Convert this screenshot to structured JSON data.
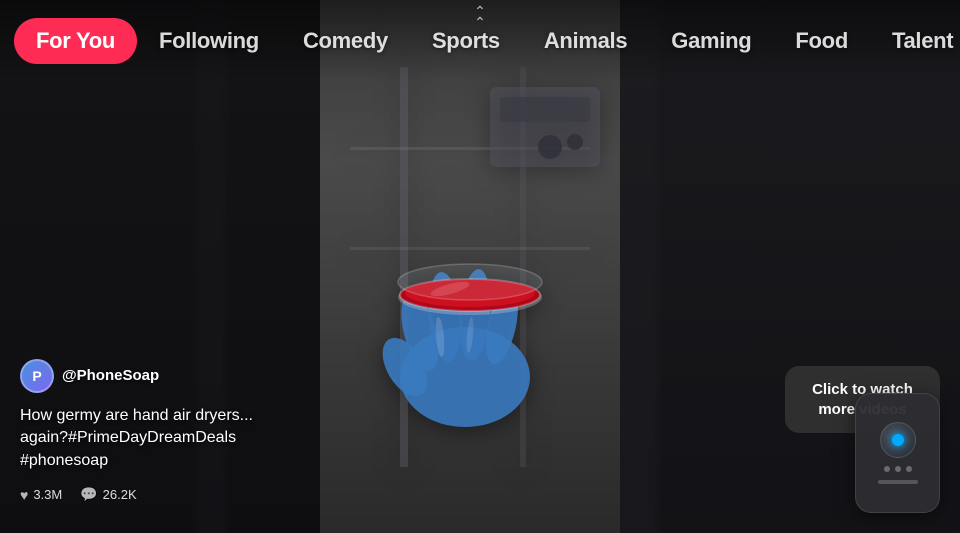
{
  "nav": {
    "chevron": "⌃",
    "tabs": [
      {
        "id": "for-you",
        "label": "For You",
        "active": true
      },
      {
        "id": "following",
        "label": "Following",
        "active": false
      },
      {
        "id": "comedy",
        "label": "Comedy",
        "active": false
      },
      {
        "id": "sports",
        "label": "Sports",
        "active": false
      },
      {
        "id": "animals",
        "label": "Animals",
        "active": false
      },
      {
        "id": "gaming",
        "label": "Gaming",
        "active": false
      },
      {
        "id": "food",
        "label": "Food",
        "active": false
      },
      {
        "id": "talent",
        "label": "Talent",
        "active": false
      }
    ]
  },
  "video": {
    "username": "@PhoneSoap",
    "description": "How germy are hand air dryers... again?#PrimeDayDreamDeals #phonesoap",
    "likes": "3.3M",
    "comments": "26.2K",
    "avatar_letter": "P"
  },
  "watch_cta": {
    "text": "Click to watch more videos"
  },
  "colors": {
    "accent": "#fe2c55",
    "indicator": "#00aaff"
  }
}
